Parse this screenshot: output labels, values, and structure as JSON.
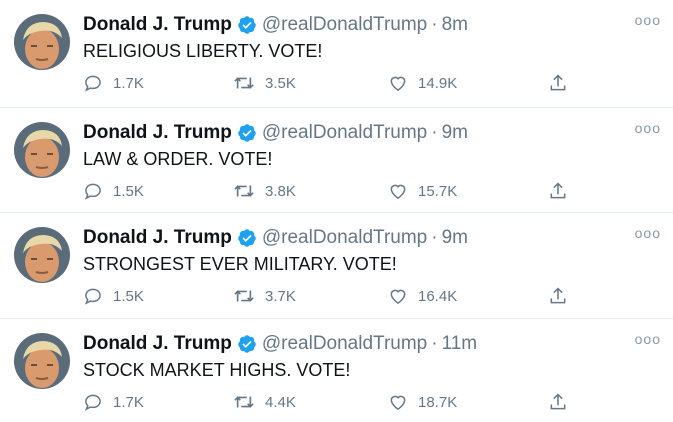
{
  "tweets": [
    {
      "author": "Donald J. Trump",
      "handle": "@realDonaldTrump",
      "time": "8m",
      "text": "RELIGIOUS LIBERTY. VOTE!",
      "replies": "1.7K",
      "retweets": "3.5K",
      "likes": "14.9K"
    },
    {
      "author": "Donald J. Trump",
      "handle": "@realDonaldTrump",
      "time": "9m",
      "text": "LAW & ORDER. VOTE!",
      "replies": "1.5K",
      "retweets": "3.8K",
      "likes": "15.7K"
    },
    {
      "author": "Donald J. Trump",
      "handle": "@realDonaldTrump",
      "time": "9m",
      "text": "STRONGEST EVER MILITARY. VOTE!",
      "replies": "1.5K",
      "retweets": "3.7K",
      "likes": "16.4K"
    },
    {
      "author": "Donald J. Trump",
      "handle": "@realDonaldTrump",
      "time": "11m",
      "text": "STOCK MARKET HIGHS. VOTE!",
      "replies": "1.7K",
      "retweets": "4.4K",
      "likes": "18.7K"
    }
  ],
  "separator": "·",
  "more_glyph": "ooo",
  "icons": {
    "avatar": "profile-photo",
    "verified": "verified-badge-icon",
    "reply": "reply-icon",
    "retweet": "retweet-icon",
    "like": "heart-icon",
    "share": "share-icon",
    "more": "more-options-icon"
  },
  "colors": {
    "verified": "#1da1f2",
    "muted": "#657786",
    "text": "#0f1419",
    "divider": "#e6ecf0"
  }
}
